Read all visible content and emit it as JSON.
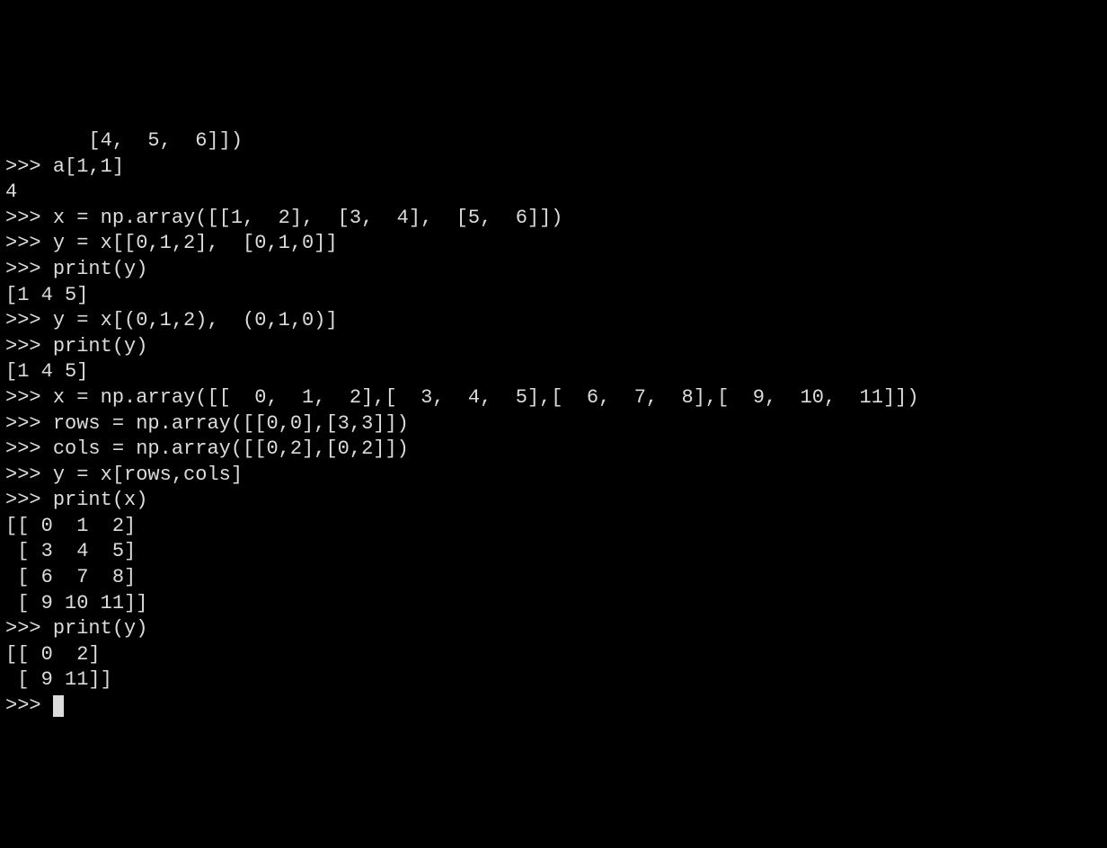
{
  "terminal": {
    "lines": [
      {
        "type": "output",
        "text": "       [4,  5,  6]])"
      },
      {
        "type": "input",
        "prompt": ">>> ",
        "text": "a[1,1]"
      },
      {
        "type": "output",
        "text": "4"
      },
      {
        "type": "input",
        "prompt": ">>> ",
        "text": "x = np.array([[1,  2],  [3,  4],  [5,  6]])"
      },
      {
        "type": "input",
        "prompt": ">>> ",
        "text": "y = x[[0,1,2],  [0,1,0]]"
      },
      {
        "type": "input",
        "prompt": ">>> ",
        "text": "print(y)"
      },
      {
        "type": "output",
        "text": "[1 4 5]"
      },
      {
        "type": "input",
        "prompt": ">>> ",
        "text": "y = x[(0,1,2),  (0,1,0)]"
      },
      {
        "type": "input",
        "prompt": ">>> ",
        "text": "print(y)"
      },
      {
        "type": "output",
        "text": "[1 4 5]"
      },
      {
        "type": "input",
        "prompt": ">>> ",
        "text": "x = np.array([[  0,  1,  2],[  3,  4,  5],[  6,  7,  8],[  9,  10,  11]])"
      },
      {
        "type": "input",
        "prompt": ">>> ",
        "text": "rows = np.array([[0,0],[3,3]])"
      },
      {
        "type": "input",
        "prompt": ">>> ",
        "text": "cols = np.array([[0,2],[0,2]])"
      },
      {
        "type": "input",
        "prompt": ">>> ",
        "text": "y = x[rows,cols]"
      },
      {
        "type": "input",
        "prompt": ">>> ",
        "text": "print(x)"
      },
      {
        "type": "output",
        "text": "[[ 0  1  2]"
      },
      {
        "type": "output",
        "text": " [ 3  4  5]"
      },
      {
        "type": "output",
        "text": " [ 6  7  8]"
      },
      {
        "type": "output",
        "text": " [ 9 10 11]]"
      },
      {
        "type": "input",
        "prompt": ">>> ",
        "text": "print(y)"
      },
      {
        "type": "output",
        "text": "[[ 0  2]"
      },
      {
        "type": "output",
        "text": " [ 9 11]]"
      },
      {
        "type": "input",
        "prompt": ">>> ",
        "text": "",
        "cursor": true
      }
    ]
  }
}
